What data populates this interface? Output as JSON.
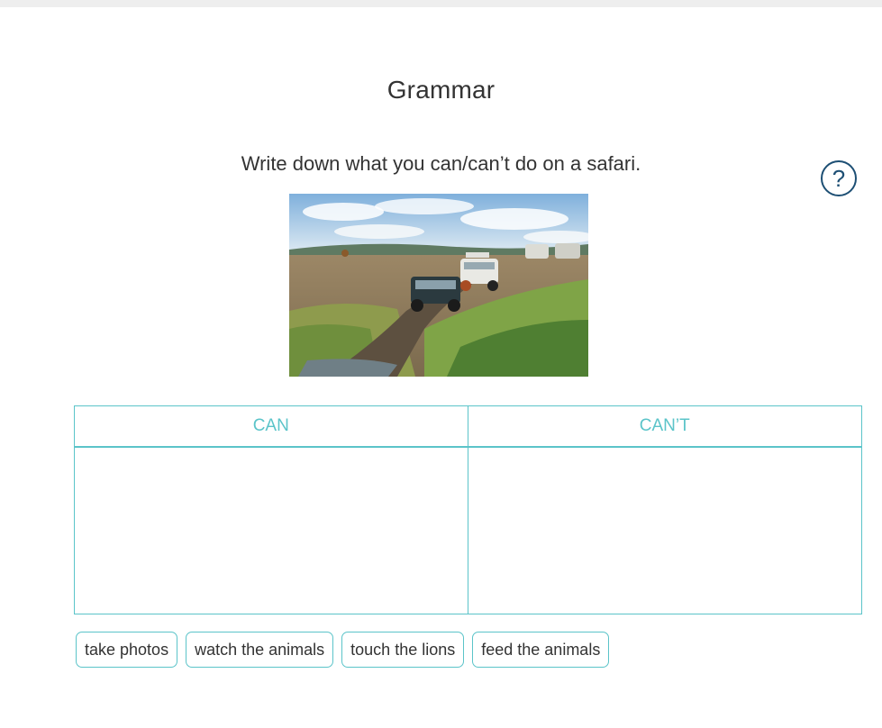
{
  "exercise": {
    "title": "Grammar",
    "instruction": "Write down what you can/can’t do on a safari.",
    "help_label": "?"
  },
  "table": {
    "columns": [
      {
        "label": "CAN"
      },
      {
        "label": "CAN’T"
      }
    ]
  },
  "answer_options": [
    {
      "label": "take photos"
    },
    {
      "label": "watch the animals"
    },
    {
      "label": "touch the lions"
    },
    {
      "label": "feed the animals"
    }
  ],
  "colors": {
    "accent": "#5bc4c9",
    "help": "#1d4f74",
    "text": "#333333"
  }
}
